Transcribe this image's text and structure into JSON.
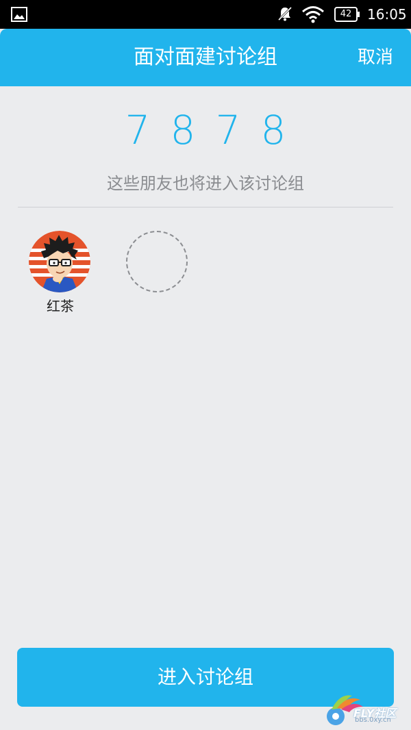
{
  "status_bar": {
    "time": "16:05",
    "battery": "42",
    "icons": [
      "image-icon",
      "notification-muted-icon",
      "wifi-icon",
      "battery-icon"
    ]
  },
  "header": {
    "title": "面对面建讨论组",
    "cancel_label": "取消"
  },
  "code": {
    "digits": [
      "7",
      "8",
      "7",
      "8"
    ]
  },
  "hint": "这些朋友也将进入该讨论组",
  "members": [
    {
      "name": "红茶"
    }
  ],
  "enter_button_label": "进入讨论组",
  "watermark": {
    "title": "FLY社区",
    "subtitle": "bbs.0xy.cn"
  },
  "colors": {
    "accent": "#21b4ec",
    "background": "#ebecee"
  }
}
